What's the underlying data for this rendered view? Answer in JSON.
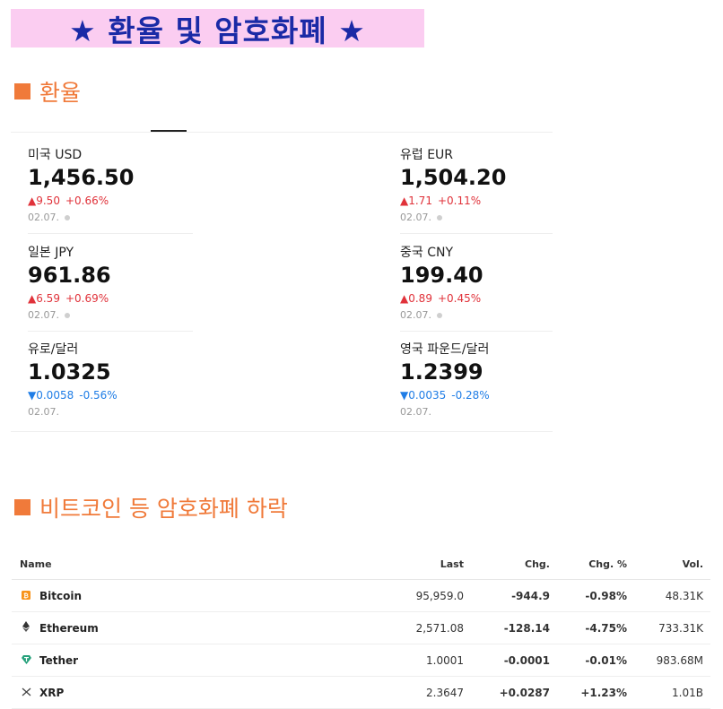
{
  "banner": {
    "title": "★ 환율 및 암호화폐 ★"
  },
  "fx_section": {
    "heading": "환율"
  },
  "fx": [
    {
      "name": "미국 USD",
      "value": "1,456.50",
      "direction": "up",
      "change_arrow": "▲",
      "change": "9.50",
      "percent": "+0.66%",
      "date": "02.07."
    },
    {
      "name": "유럽 EUR",
      "value": "1,504.20",
      "direction": "up",
      "change_arrow": "▲",
      "change": "1.71",
      "percent": "+0.11%",
      "date": "02.07."
    },
    {
      "name": "일본 JPY",
      "value": "961.86",
      "direction": "up",
      "change_arrow": "▲",
      "change": "6.59",
      "percent": "+0.69%",
      "date": "02.07."
    },
    {
      "name": "중국 CNY",
      "value": "199.40",
      "direction": "up",
      "change_arrow": "▲",
      "change": "0.89",
      "percent": "+0.45%",
      "date": "02.07."
    },
    {
      "name": "유로/달러",
      "value": "1.0325",
      "direction": "down",
      "change_arrow": "▼",
      "change": "0.0058",
      "percent": "-0.56%",
      "date": "02.07."
    },
    {
      "name": "영국 파운드/달러",
      "value": "1.2399",
      "direction": "down",
      "change_arrow": "▼",
      "change": "0.0035",
      "percent": "-0.28%",
      "date": "02.07."
    }
  ],
  "crypto_section": {
    "heading": "비트코인 등 암호화폐 하락"
  },
  "crypto_table": {
    "columns": [
      "Name",
      "Last",
      "Chg.",
      "Chg. %",
      "Vol."
    ],
    "rows": [
      {
        "icon": "bitcoin-icon",
        "name": "Bitcoin",
        "last": "95,959.0",
        "chg": "-944.9",
        "chg_pct": "-0.98%",
        "vol": "48.31K",
        "trend": "down"
      },
      {
        "icon": "ethereum-icon",
        "name": "Ethereum",
        "last": "2,571.08",
        "chg": "-128.14",
        "chg_pct": "-4.75%",
        "vol": "733.31K",
        "trend": "down"
      },
      {
        "icon": "tether-icon",
        "name": "Tether",
        "last": "1.0001",
        "chg": "-0.0001",
        "chg_pct": "-0.01%",
        "vol": "983.68M",
        "trend": "down"
      },
      {
        "icon": "xrp-icon",
        "name": "XRP",
        "last": "2.3647",
        "chg": "+0.0287",
        "chg_pct": "+1.23%",
        "vol": "1.01B",
        "trend": "up"
      }
    ]
  },
  "colors": {
    "banner_bg": "#fbcdf1",
    "banner_text": "#1a2aa6",
    "heading": "#f07a3a",
    "up": "#e0323a",
    "down": "#1f7de6",
    "positive": "#22a23a"
  }
}
